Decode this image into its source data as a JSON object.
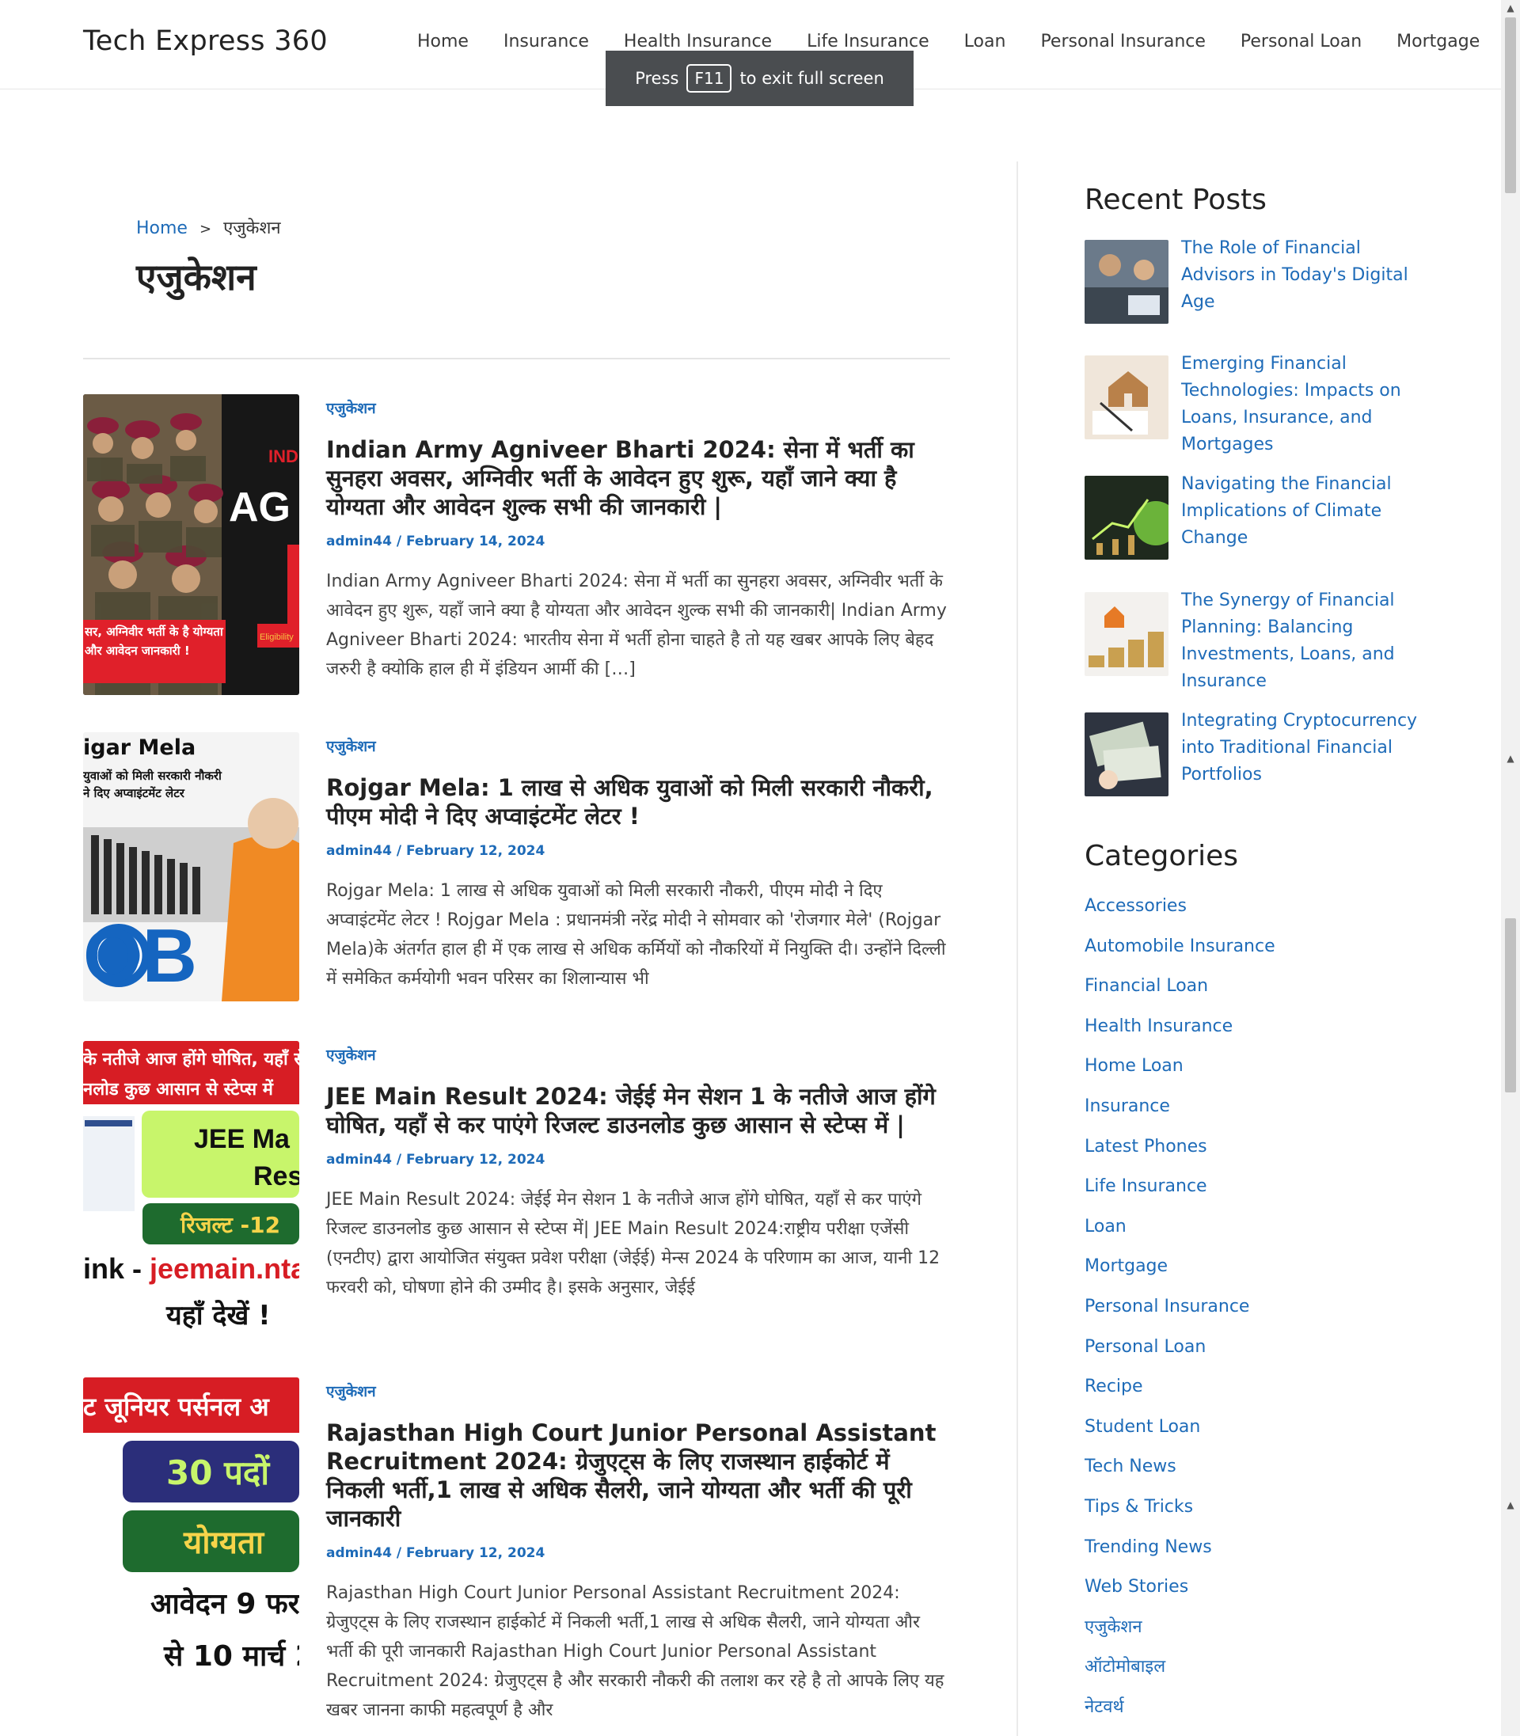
{
  "site": {
    "title": "Tech Express 360"
  },
  "nav": {
    "items": [
      "Home",
      "Insurance",
      "Health Insurance",
      "Life Insurance",
      "Loan",
      "Personal Insurance",
      "Personal Loan",
      "Mortgage"
    ]
  },
  "fullscreen_notice": {
    "before": "Press",
    "key": "F11",
    "after": "to exit full screen"
  },
  "breadcrumb": {
    "home": "Home",
    "sep": ">",
    "current": "एजुकेशन"
  },
  "page": {
    "title": "एजुकेशन"
  },
  "posts": [
    {
      "category": "एजुकेशन",
      "title": "Indian Army Agniveer Bharti 2024: सेना में भर्ती का सुनहरा अवसर, अग्निवीर भर्ती के आवेदन हुए शुरू, यहाँ जाने क्या है योग्यता और आवेदन शुल्क सभी की जानकारी |",
      "meta": "admin44 / February 14, 2024",
      "excerpt": "Indian Army Agniveer Bharti 2024: सेना में भर्ती का सुनहरा अवसर, अग्निवीर भर्ती के आवेदन हुए शुरू, यहाँ जाने क्या है योग्यता और आवेदन शुल्क सभी की जानकारी| Indian Army Agniveer Bharti 2024: भारतीय सेना में भर्ती होना चाहते है तो यह खबर आपके लिए बेहद जरुरी है क्योकि हाल ही में इंडियन आर्मी की […]",
      "thumb": {
        "text_main": "AG",
        "text_top": "INDI",
        "caption": "सर, अग्निवीर भर्ती के है योग्यता और आवेदन जानकारी !",
        "tag": "Eligibility"
      }
    },
    {
      "category": "एजुकेशन",
      "title": "Rojgar Mela: 1 लाख से अधिक युवाओं को मिली सरकारी नौकरी, पीएम मोदी ने दिए अप्वाइंटमेंट लेटर !",
      "meta": "admin44 / February 12, 2024",
      "excerpt": "Rojgar Mela: 1 लाख से अधिक युवाओं को मिली सरकारी नौकरी, पीएम मोदी ने दिए अप्वाइंटमेंट लेटर ! Rojgar Mela : प्रधानमंत्री नरेंद्र मोदी ने सोमवार को 'रोजगार मेले' (Rojgar Mela)के अंतर्गत हाल ही में एक लाख से अधिक कर्मियों को नौकरियों में नियुक्ति दी। उन्होंने दिल्ली में समेकित कर्मयोगी भवन परिसर का शिलान्यास भी",
      "thumb": {
        "heading": "igar Mela",
        "line1": "युवाओं को मिली सरकारी नौकरी",
        "line2": "ने दिए अप्वाइंटमेंट लेटर",
        "big": "OB"
      }
    },
    {
      "category": "एजुकेशन",
      "title": "JEE Main Result 2024: जेईई मेन सेशन 1 के नतीजे आज होंगे घोषित, यहाँ से कर पाएंगे रिजल्ट डाउनलोड कुछ आसान से स्टेप्स में |",
      "meta": "admin44 / February 12, 2024",
      "excerpt": "JEE Main Result 2024: जेईई मेन सेशन 1 के नतीजे आज होंगे घोषित, यहाँ से कर पाएंगे रिजल्ट डाउनलोड कुछ आसान से स्टेप्स में| JEE Main Result 2024:राष्ट्रीय परीक्षा एजेंसी (एनटीए) द्वारा आयोजित संयुक्त प्रवेश परीक्षा (जेईई) मेन्स 2024 के परिणाम का आज, यानी 12 फरवरी को, घोषणा होने की उम्मीद है। इसके अनुसार, जेईई",
      "thumb": {
        "banner1": "के नतीजे आज होंगे घोषित, यहाँ से",
        "banner2": "नलोड कुछ आसान से स्टेप्स में",
        "box1": "JEE Ma",
        "box1b": "Res",
        "box2": "रिजल्ट -12",
        "link_prefix": "ink - ",
        "link": "jeemain.nta.",
        "footer": "यहाँ देखें !"
      }
    },
    {
      "category": "एजुकेशन",
      "title": "Rajasthan High Court Junior Personal Assistant Recruitment 2024: ग्रेजुएट्स के लिए राजस्थान हाईकोर्ट में निकली भर्ती,1 लाख से अधिक सैलरी, जाने योग्यता और भर्ती की पूरी जानकारी",
      "meta": "admin44 / February 12, 2024",
      "excerpt": "Rajasthan High Court Junior Personal Assistant Recruitment 2024: ग्रेजुएट्स के लिए राजस्थान हाईकोर्ट में निकली भर्ती,1 लाख से अधिक सैलरी, जाने योग्यता और भर्ती की पूरी जानकारी Rajasthan High Court Junior Personal Assistant Recruitment 2024: ग्रेजुएट्स है और सरकारी नौकरी की तलाश कर रहे है तो आपके लिए यह खबर जानना काफी महत्वपूर्ण है और",
      "thumb": {
        "banner": "ट जूनियर पर्सनल अ",
        "box1": "30 पदों",
        "box2": "योग्यता",
        "line1": "आवेदन 9 फर",
        "line2": "से 10 मार्च 2"
      }
    }
  ],
  "sidebar": {
    "recent_title": "Recent Posts",
    "recent_posts": [
      "The Role of Financial Advisors in Today's Digital Age",
      "Emerging Financial Technologies: Impacts on Loans, Insurance, and Mortgages",
      "Navigating the Financial Implications of Climate Change",
      "The Synergy of Financial Planning: Balancing Investments, Loans, and Insurance",
      "Integrating Cryptocurrency into Traditional Financial Portfolios"
    ],
    "categories_title": "Categories",
    "categories": [
      "Accessories",
      "Automobile Insurance",
      "Financial Loan",
      "Health Insurance",
      "Home Loan",
      "Insurance",
      "Latest Phones",
      "Life Insurance",
      "Loan",
      "Mortgage",
      "Personal Insurance",
      "Personal Loan",
      "Recipe",
      "Student Loan",
      "Tech News",
      "Tips & Tricks",
      "Trending News",
      "Web Stories",
      "एजुकेशन",
      "ऑटोमोबाइल",
      "नेटवर्थ"
    ]
  },
  "colors": {
    "link": "#1e6bb8",
    "heading": "#222222",
    "notice_bg": "#4a4d50"
  }
}
